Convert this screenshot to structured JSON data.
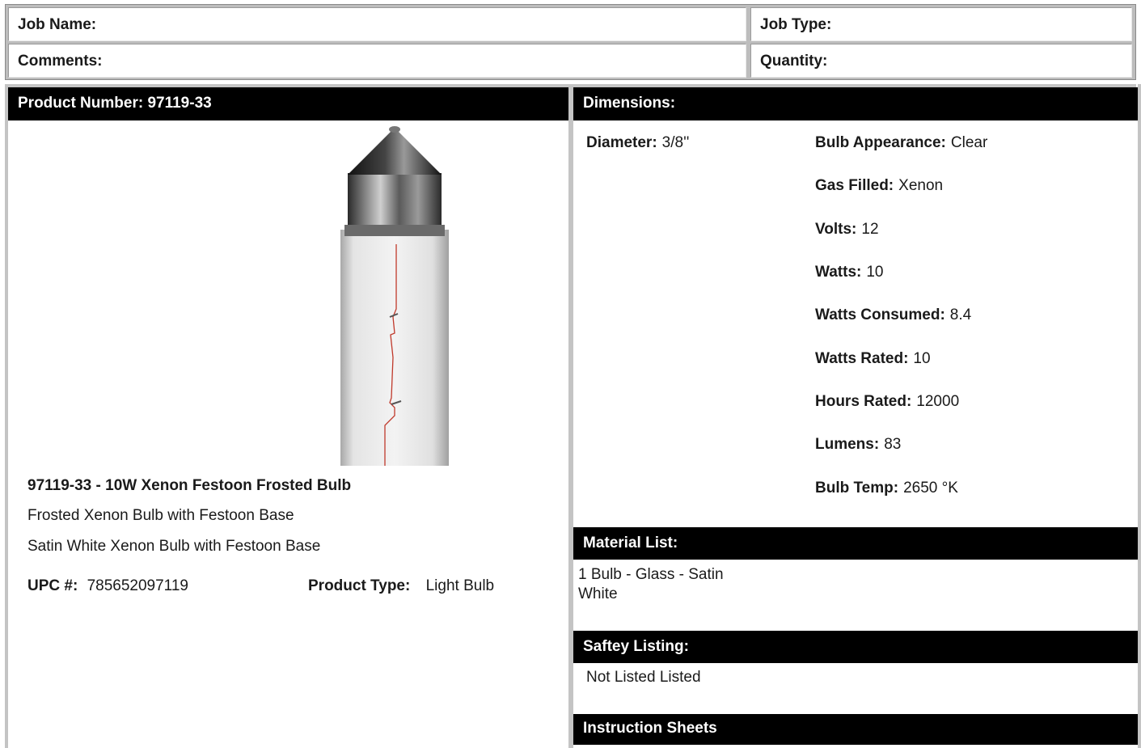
{
  "job": {
    "job_name_label": "Job Name:",
    "job_type_label": "Job Type:",
    "comments_label": "Comments:",
    "quantity_label": "Quantity:"
  },
  "product": {
    "header": "Product Number: 97119-33",
    "title": "97119-33 - 10W Xenon Festoon Frosted Bulb",
    "desc1": "Frosted Xenon Bulb with Festoon Base",
    "desc2": "Satin White Xenon Bulb with Festoon Base",
    "upc_label": "UPC #:",
    "upc_value": "785652097119",
    "type_label": "Product Type:",
    "type_value": "Light Bulb"
  },
  "dimensions": {
    "header": "Dimensions:",
    "diameter_label": "Diameter:",
    "diameter_value": "3/8''",
    "specs": [
      {
        "label": "Bulb Appearance:",
        "value": "Clear"
      },
      {
        "label": "Gas Filled:",
        "value": "Xenon"
      },
      {
        "label": "Volts:",
        "value": "12"
      },
      {
        "label": "Watts:",
        "value": "10"
      },
      {
        "label": "Watts Consumed:",
        "value": "8.4"
      },
      {
        "label": "Watts Rated:",
        "value": "10"
      },
      {
        "label": "Hours Rated:",
        "value": "12000"
      },
      {
        "label": "Lumens:",
        "value": "83"
      },
      {
        "label": "Bulb Temp:",
        "value": "2650 °K"
      }
    ]
  },
  "material": {
    "header": "Material List:",
    "line1": "1 Bulb - Glass - Satin",
    "line2": "White"
  },
  "safety": {
    "header": "Saftey Listing:",
    "value": "Not Listed Listed"
  },
  "instructions": {
    "header": "Instruction Sheets"
  }
}
